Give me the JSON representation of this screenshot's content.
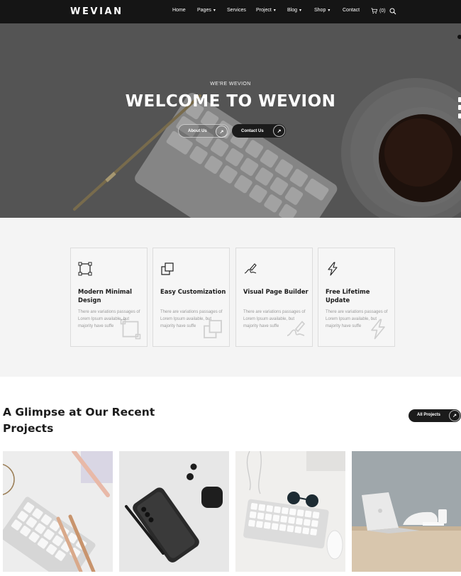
{
  "nav": {
    "logo": "WEVIAN",
    "items": [
      {
        "label": "Home",
        "dropdown": false
      },
      {
        "label": "Pages",
        "dropdown": true
      },
      {
        "label": "Services",
        "dropdown": false
      },
      {
        "label": "Project",
        "dropdown": true
      },
      {
        "label": "Blog",
        "dropdown": true
      },
      {
        "label": "Shop",
        "dropdown": true
      },
      {
        "label": "Contact",
        "dropdown": false
      }
    ],
    "cart_count": "(0)",
    "icons": [
      "cart-icon",
      "search-icon",
      "chevron-down-icon"
    ]
  },
  "hero": {
    "tagline": "WE'RE WEVION",
    "title": "WELCOME TO WEVION",
    "about_button": "About Us",
    "contact_button": "Contact Us",
    "arrow_glyph": "↗"
  },
  "features": [
    {
      "icon": "vector-square-icon",
      "title": "Modern Minimal Design",
      "text": "There are variations passages of Lorem Ipsum available, but majority have suffe"
    },
    {
      "icon": "copy-icon",
      "title": "Easy Customization",
      "text": "There are variations passages of Lorem Ipsum available, but majority have suffe"
    },
    {
      "icon": "signature-icon",
      "title": "Visual Page Builder",
      "text": "There are variations passages of Lorem Ipsum available, but majority have suffe"
    },
    {
      "icon": "lightning-icon",
      "title": "Free Lifetime Update",
      "text": "There are variations passages of Lorem Ipsum available, but majority have suffe"
    }
  ],
  "projects": {
    "title_line1": "A Glimpse at Our Recent",
    "title_line2": "Projects",
    "all_button": "All Projects",
    "images": [
      "keyboard-and-pens-photo",
      "smartphone-and-earbuds-photo",
      "keyboard-and-sunglasses-photo",
      "laptop-on-desk-photo"
    ]
  },
  "colors": {
    "nav_bg": "#151515",
    "accent_dark": "#1b1b1b",
    "hero_overlay": "#5e5e5e",
    "features_bg": "#f4f4f4"
  }
}
